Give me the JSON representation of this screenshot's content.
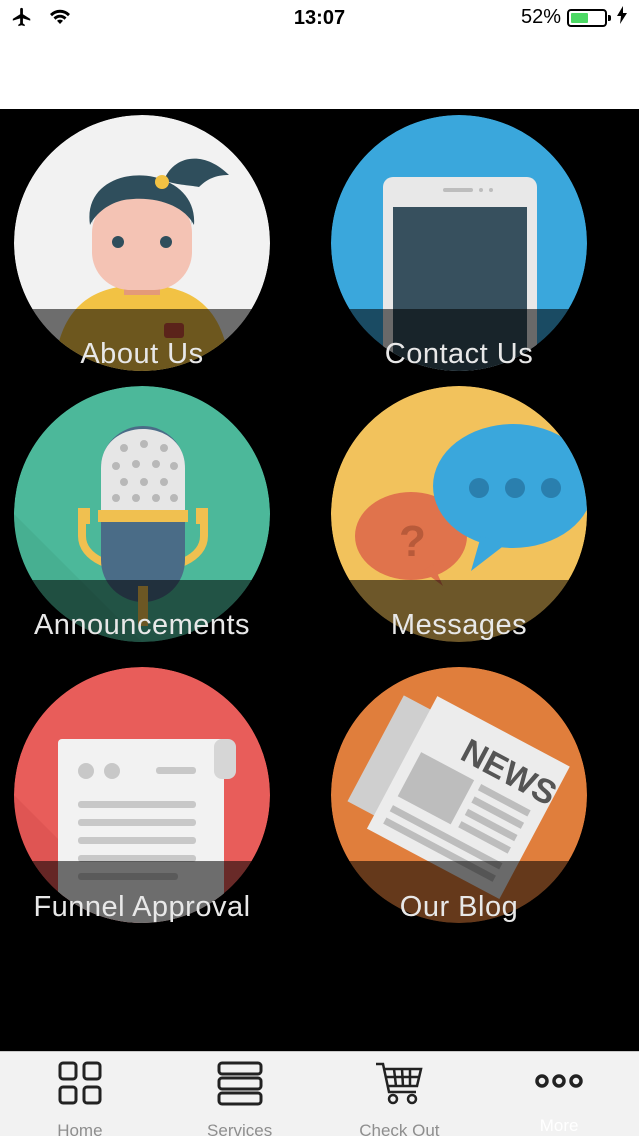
{
  "status_bar": {
    "time": "13:07",
    "battery_percent": "52%",
    "battery_level": 0.52,
    "icons": [
      "airplane-icon",
      "wifi-icon",
      "battery-icon",
      "charging-bolt-icon"
    ]
  },
  "tiles": [
    {
      "label": "About Us",
      "icon": "person-avatar-icon",
      "color": "#f2f2f2"
    },
    {
      "label": "Contact Us",
      "icon": "phone-icon",
      "color": "#3aa7dc"
    },
    {
      "label": "Announcements",
      "icon": "microphone-icon",
      "color": "#4cb89a"
    },
    {
      "label": "Messages",
      "icon": "chat-bubbles-icon",
      "color": "#f2c25c"
    },
    {
      "label": "Funnel Approval",
      "icon": "document-icon",
      "color": "#e85d5a"
    },
    {
      "label": "Our Blog",
      "icon": "newspaper-icon",
      "color": "#e07e3c"
    }
  ],
  "newspaper_text": "NEWS",
  "tab_bar": {
    "tabs": [
      {
        "label": "Home",
        "icon": "grid-icon"
      },
      {
        "label": "Services",
        "icon": "stack-icon"
      },
      {
        "label": "Check Out",
        "icon": "cart-icon"
      },
      {
        "label": "More",
        "icon": "more-dots-icon",
        "active": true
      }
    ]
  }
}
